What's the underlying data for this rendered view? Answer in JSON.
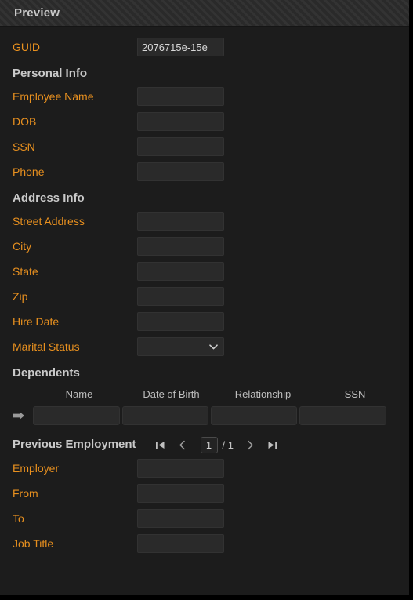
{
  "header": {
    "title": "Preview"
  },
  "guid": {
    "label": "GUID",
    "value": "2076715e-15e"
  },
  "sections": {
    "personal": {
      "heading": "Personal Info",
      "fields": [
        {
          "label": "Employee Name",
          "value": ""
        },
        {
          "label": "DOB",
          "value": ""
        },
        {
          "label": "SSN",
          "value": ""
        },
        {
          "label": "Phone",
          "value": ""
        }
      ]
    },
    "address": {
      "heading": "Address Info",
      "fields": [
        {
          "label": "Street Address",
          "value": ""
        },
        {
          "label": "City",
          "value": ""
        },
        {
          "label": "State",
          "value": ""
        },
        {
          "label": "Zip",
          "value": ""
        },
        {
          "label": "Hire Date",
          "value": ""
        }
      ],
      "marital": {
        "label": "Marital Status",
        "value": "",
        "icon": "chevron-down-icon"
      }
    },
    "dependents": {
      "heading": "Dependents",
      "columns": [
        "Name",
        "Date of Birth",
        "Relationship",
        "SSN"
      ],
      "rows": [
        {
          "indicator": "row-pointer-icon",
          "name": "",
          "dob": "",
          "relationship": "",
          "ssn": ""
        }
      ]
    },
    "previous_employment": {
      "heading": "Previous Employment",
      "pager": {
        "first_icon": "first-page-icon",
        "prev_icon": "previous-page-icon",
        "page": "1",
        "total": "/ 1",
        "next_icon": "next-page-icon",
        "last_icon": "last-page-icon"
      },
      "fields": [
        {
          "label": "Employer",
          "value": ""
        },
        {
          "label": "From",
          "value": ""
        },
        {
          "label": "To",
          "value": ""
        },
        {
          "label": "Job Title",
          "value": ""
        }
      ]
    }
  },
  "colors": {
    "label": "#e8901f",
    "heading": "#c9c9c9",
    "background": "#1c1c1c",
    "field": "#2a2a2a"
  }
}
